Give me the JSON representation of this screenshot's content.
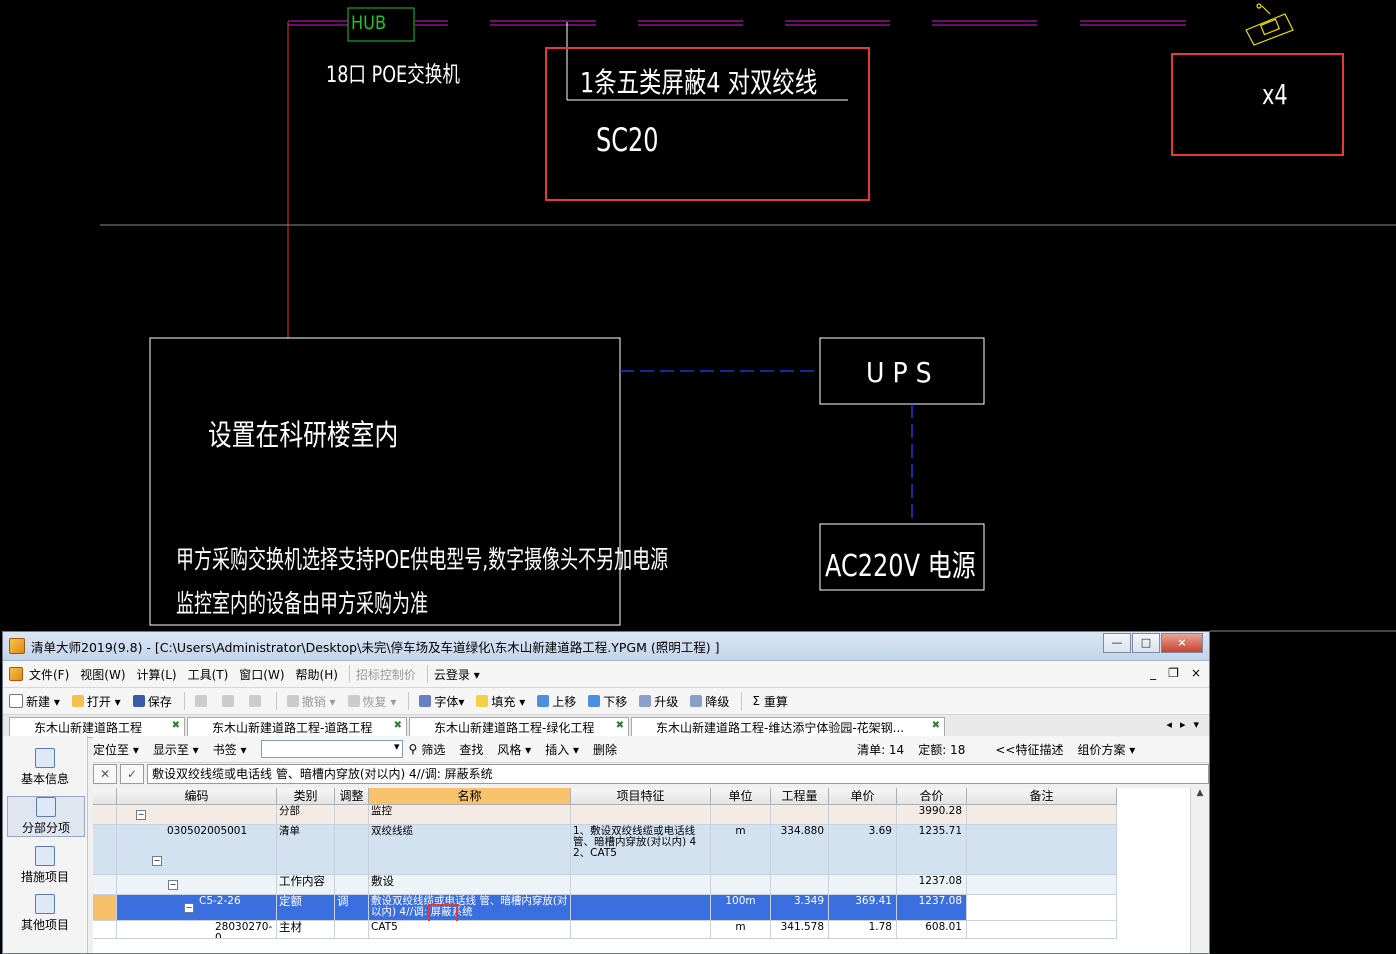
{
  "cad": {
    "hub_label": "HUB",
    "switch_label": "18口 POE交换机",
    "cable_label": "1条五类屏蔽4 对双绞线",
    "conduit_label": "SC20",
    "camera_count": "x4",
    "room_label": "设置在科研楼室内",
    "note_line1": "甲方采购交换机选择支持POE供电型号,数字摄像头不另加电源",
    "note_line2": "监控室内的设备由甲方采购为准",
    "ups_label": "U P S",
    "power_label": "AC220V 电源",
    "colors": {
      "magenta": "#d020d0",
      "red": "#e53935",
      "green": "#22c322",
      "blue": "#2a3cff",
      "yellow": "#f0e000"
    }
  },
  "window": {
    "title": "清单大师2019(9.8) - [C:\\Users\\Administrator\\Desktop\\未完\\停车场及车道绿化\\东木山新建道路工程.YPGM (照明工程) ]",
    "controls": [
      "—",
      "□",
      "×"
    ],
    "mdi_controls": [
      "_",
      "❐",
      "×"
    ]
  },
  "menu": {
    "items": [
      "文件(F)",
      "视图(W)",
      "计算(L)",
      "工具(T)",
      "窗口(W)",
      "帮助(H)"
    ],
    "bid_control": "招标控制价",
    "cloud_login": "云登录 ▾"
  },
  "toolbar": {
    "new": "新建 ▾",
    "open": "打开 ▾",
    "save": "保存",
    "undo": "撤销 ▾",
    "redo": "恢复 ▾",
    "font": "字体▾",
    "fill": "填充 ▾",
    "move_up": "上移",
    "move_down": "下移",
    "upgrade": "升级",
    "downgrade": "降级",
    "recalc": "重算"
  },
  "tabs": [
    "东木山新建道路工程",
    "东木山新建道路工程-道路工程",
    "东木山新建道路工程-绿化工程",
    "东木山新建道路工程-维达添宁体验园-花架钢..."
  ],
  "tab_nav": [
    "◂",
    "▸",
    "▾"
  ],
  "left_panel": [
    "基本信息",
    "分部分项",
    "措施项目",
    "其他项目"
  ],
  "subtoolbar": {
    "locate": "定位至 ▾",
    "show": "显示至 ▾",
    "bookmark": "书签 ▾",
    "filter": "筛选",
    "find": "查找",
    "style": "风格 ▾",
    "insert": "插入 ▾",
    "delete": "删除",
    "list_count": "清单: 14",
    "quota_count": "定额: 18",
    "feature_desc": "<<特征描述",
    "pricing_plan": "组价方案 ▾"
  },
  "editbar": {
    "cancel": "✕",
    "confirm": "✓",
    "value": "敷设双绞线缆或电话线 管、暗槽内穿放(对以内) 4//调: 屏蔽系统"
  },
  "grid": {
    "headers": [
      "编码",
      "类别",
      "调整",
      "名称",
      "项目特征",
      "单位",
      "工程量",
      "单价",
      "合价",
      "备注"
    ],
    "rows": [
      {
        "kind": "fenbu",
        "code": "",
        "type": "分部",
        "adj": "",
        "name": "监控",
        "feature": "",
        "unit": "",
        "qty": "",
        "price": "",
        "total": "3990.28",
        "remark": ""
      },
      {
        "kind": "qd",
        "code": "030502005001",
        "type": "清单",
        "adj": "",
        "name": "双绞线缆",
        "feature": "1、敷设双绞线缆或电话线 管、暗槽内穿放(对以内) 4\n2、CAT5",
        "unit": "m",
        "qty": "334.880",
        "price": "3.69",
        "total": "1235.71",
        "remark": ""
      },
      {
        "kind": "gz",
        "code": "",
        "type": "工作内容",
        "adj": "",
        "name": "敷设",
        "feature": "",
        "unit": "",
        "qty": "",
        "price": "",
        "total": "1237.08",
        "remark": ""
      },
      {
        "kind": "de",
        "code": "C5-2-26",
        "type": "定额",
        "adj": "调",
        "name": "敷设双绞线缆或电话线 管、暗槽内穿放(对以内) 4//调: 屏蔽系统",
        "feature": "",
        "unit": "100m",
        "qty": "3.349",
        "price": "369.41",
        "total": "1237.08",
        "remark": ""
      },
      {
        "kind": "cl",
        "code": "28030270-0",
        "type": "主材",
        "adj": "",
        "name": "CAT5",
        "feature": "",
        "unit": "m",
        "qty": "341.578",
        "price": "1.78",
        "total": "608.01",
        "remark": ""
      }
    ]
  }
}
